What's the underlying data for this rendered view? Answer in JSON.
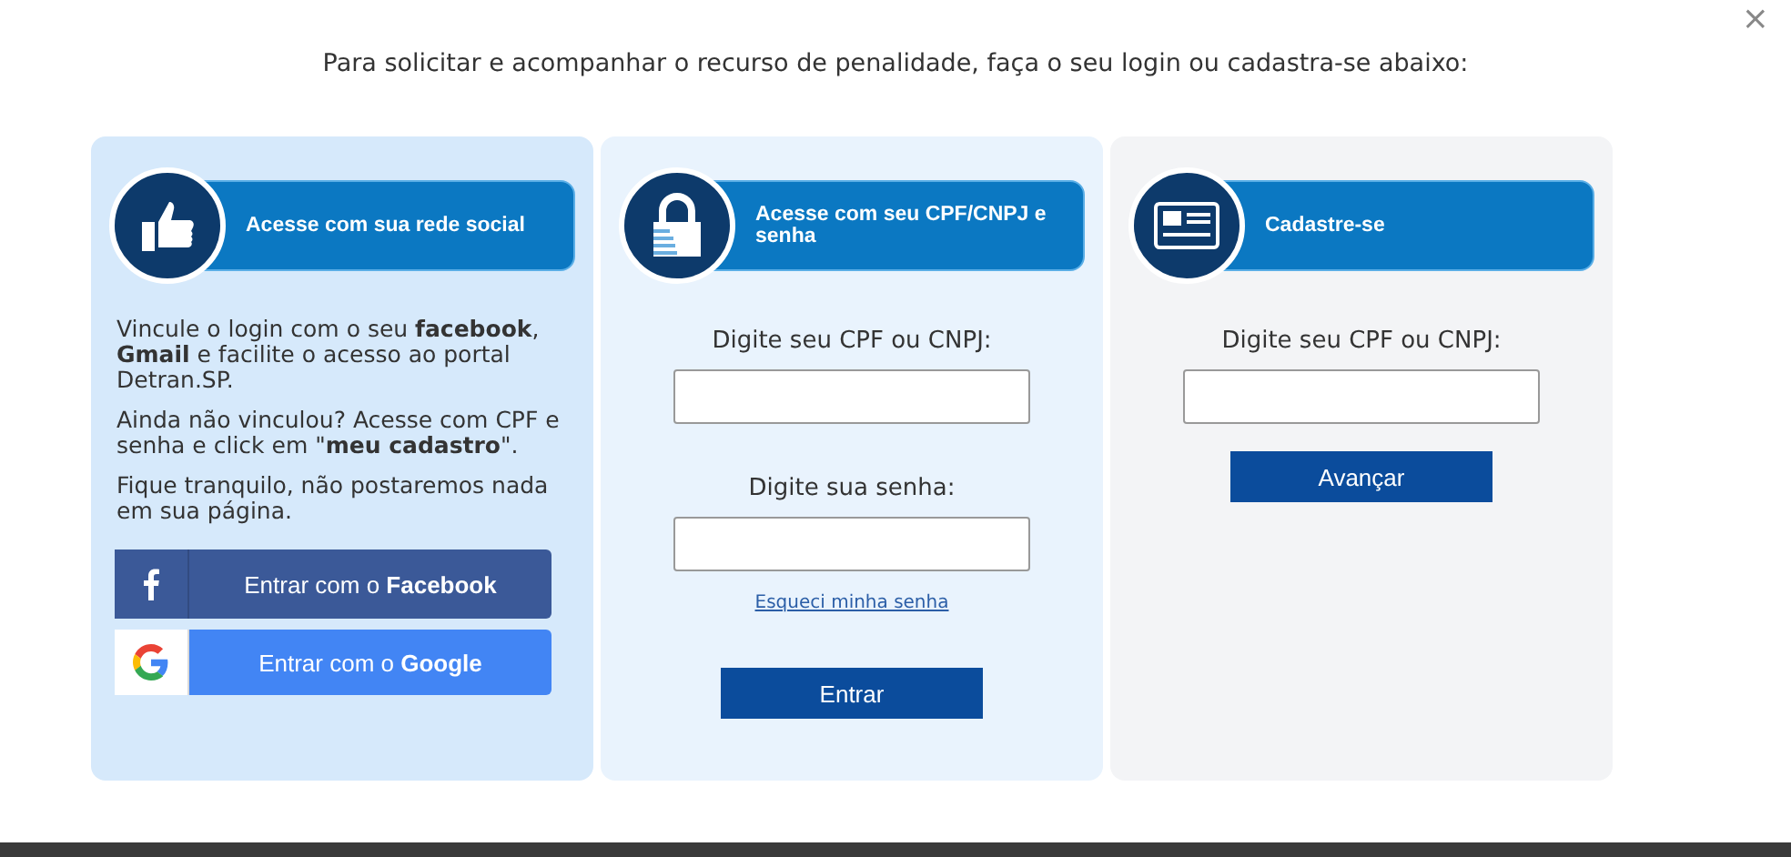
{
  "close": "×",
  "intro": "Para solicitar e acompanhar o recurso de penalidade, faça o seu login ou cadastra-se abaixo:",
  "panels": [
    {
      "kind": "social",
      "header": "Acesse com sua rede social",
      "paragraphs": [
        "Vincule o login com o seu **facebook**, **Gmail** e facilite o acesso ao portal Detran.SP.",
        "Ainda não vinculou? Acesse com CPF e senha e click em \"**meu cadastro**\".",
        "Fique tranquilo, não postaremos nada em sua página."
      ],
      "buttons": [
        {
          "kind": "facebook",
          "label": "Entrar com o **Facebook**"
        },
        {
          "kind": "google",
          "label": "Entrar com o **Google**"
        }
      ]
    },
    {
      "kind": "login",
      "header": "Acesse com seu CPF/CNPJ e senha",
      "fields": [
        {
          "label": "Digite seu CPF ou CNPJ:"
        },
        {
          "label": "Digite sua senha:"
        }
      ],
      "link": "Esqueci minha senha",
      "button": "Entrar"
    },
    {
      "kind": "register",
      "header": "Cadastre-se",
      "fields": [
        {
          "label": "Digite seu CPF ou CNPJ:"
        }
      ],
      "button": "Avançar"
    }
  ]
}
